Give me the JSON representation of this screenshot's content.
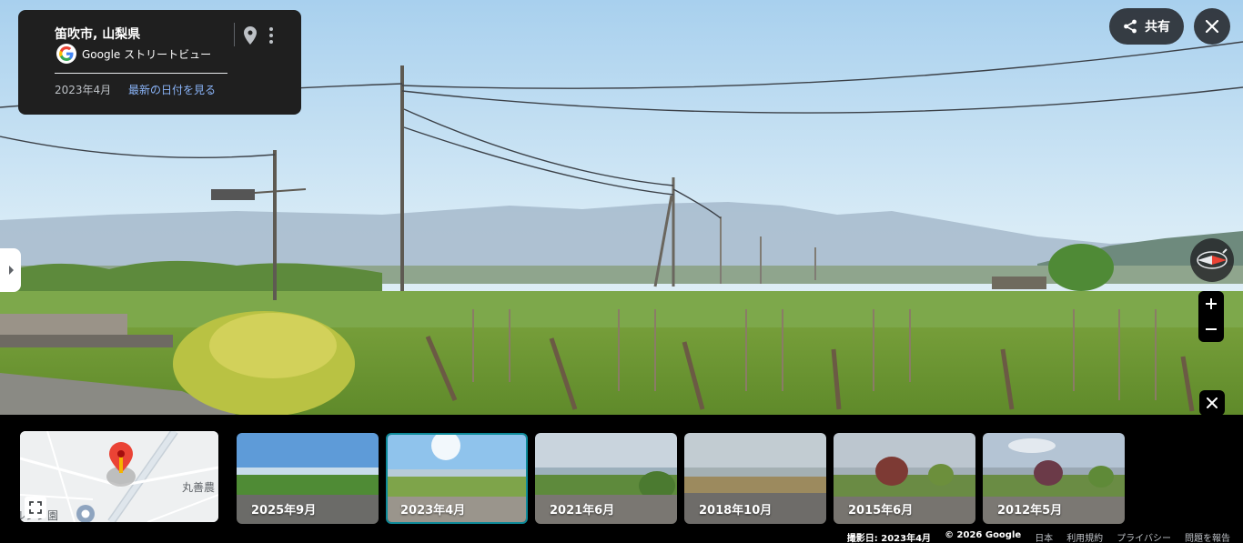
{
  "info_card": {
    "place": "笛吹市, 山梨県",
    "product": "Google ストリートビュー",
    "date": "2023年4月",
    "latest_link": "最新の日付を見る",
    "icons": [
      "google-logo",
      "location-pin-icon",
      "more-vert-icon"
    ]
  },
  "top_right": {
    "share_label": "共有",
    "icons": [
      "share-icon",
      "close-icon"
    ]
  },
  "side_controls": {
    "icons": [
      "chevron-right-icon",
      "compass-icon",
      "plus-icon",
      "minus-icon",
      "close-icon"
    ]
  },
  "mini_map": {
    "place_label": "丸善農",
    "partial_label": "ルシン園",
    "icons": [
      "map-pin-icon",
      "fullscreen-icon",
      "location-dot-icon"
    ]
  },
  "timeline": [
    {
      "label": "2025年9月",
      "selected": false
    },
    {
      "label": "2023年4月",
      "selected": true
    },
    {
      "label": "2021年6月",
      "selected": false
    },
    {
      "label": "2018年10月",
      "selected": false
    },
    {
      "label": "2015年6月",
      "selected": false
    },
    {
      "label": "2012年5月",
      "selected": false
    }
  ],
  "footer": {
    "capture_date": "撮影日: 2023年4月",
    "copyright": "© 2026 Google",
    "region": "日本",
    "terms": "利用規約",
    "privacy": "プライバシー",
    "report": "問題を報告"
  },
  "colors": {
    "accent_link": "#8ab4f8",
    "selected_border": "#0e8a99",
    "pin_red": "#ea4335"
  }
}
